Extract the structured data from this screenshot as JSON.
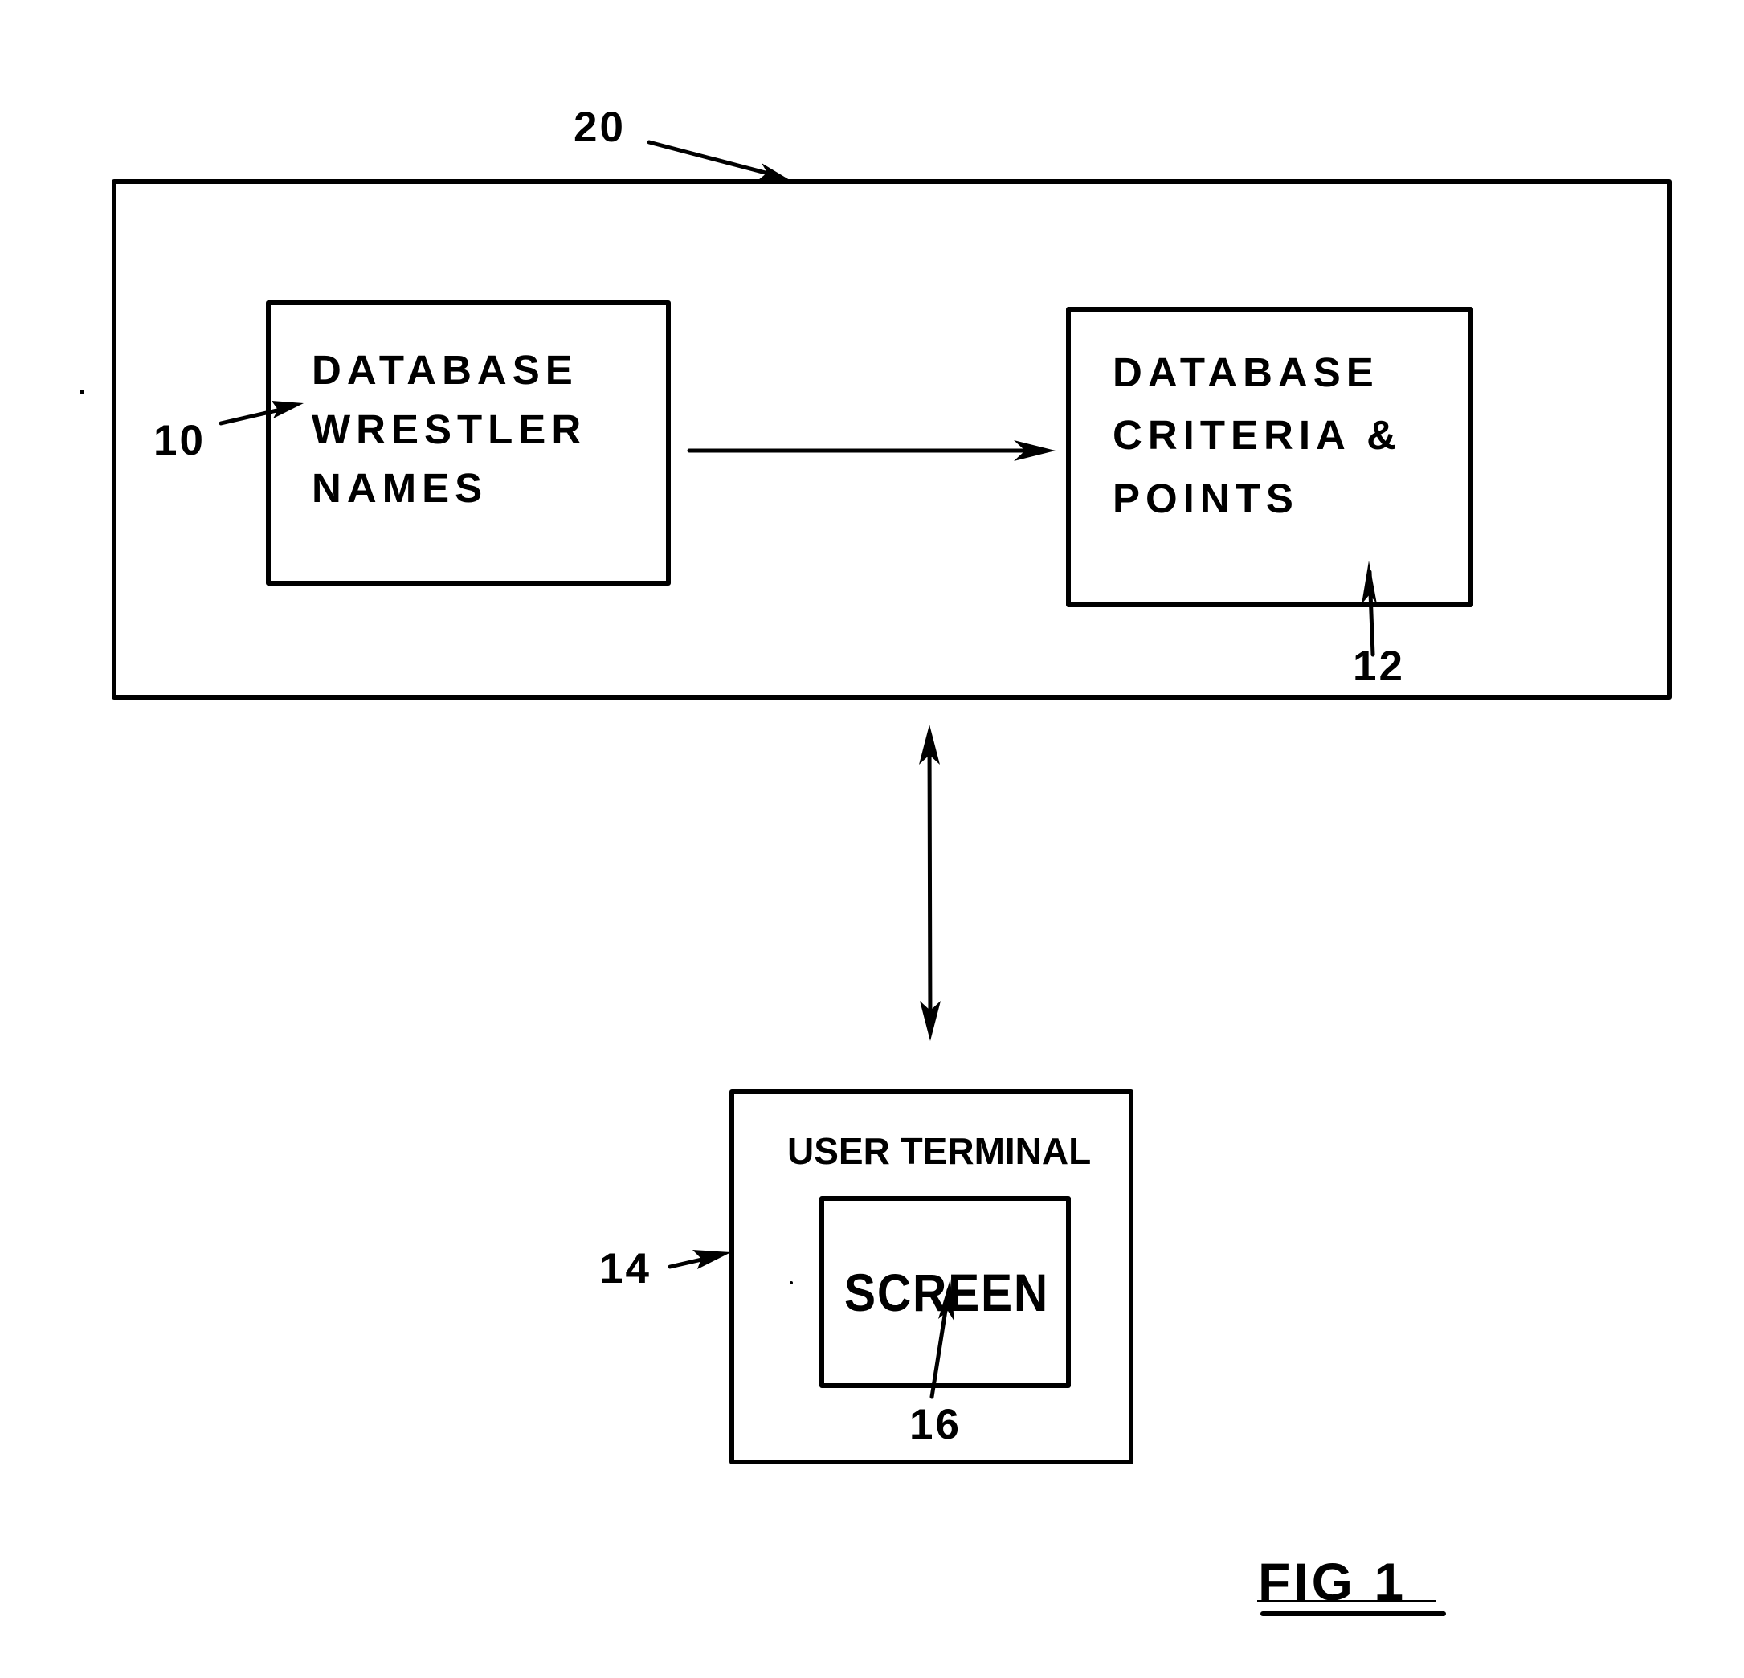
{
  "figure": {
    "label": "FIG 1"
  },
  "system": {
    "ref": "20"
  },
  "wrestler_db": {
    "ref": "10",
    "lines": [
      "DATABASE",
      "WRESTLER",
      "NAMES"
    ]
  },
  "criteria_db": {
    "ref": "12",
    "lines": [
      "DATABASE",
      "CRITERIA &",
      "POINTS"
    ]
  },
  "user_terminal": {
    "ref": "14",
    "label": "USER TERMINAL"
  },
  "screen": {
    "ref": "16",
    "label": "SCREEN"
  },
  "connections": [
    {
      "from": "wrestler_db",
      "to": "criteria_db",
      "direction": "one-way"
    },
    {
      "from": "system",
      "to": "user_terminal",
      "direction": "two-way"
    }
  ]
}
